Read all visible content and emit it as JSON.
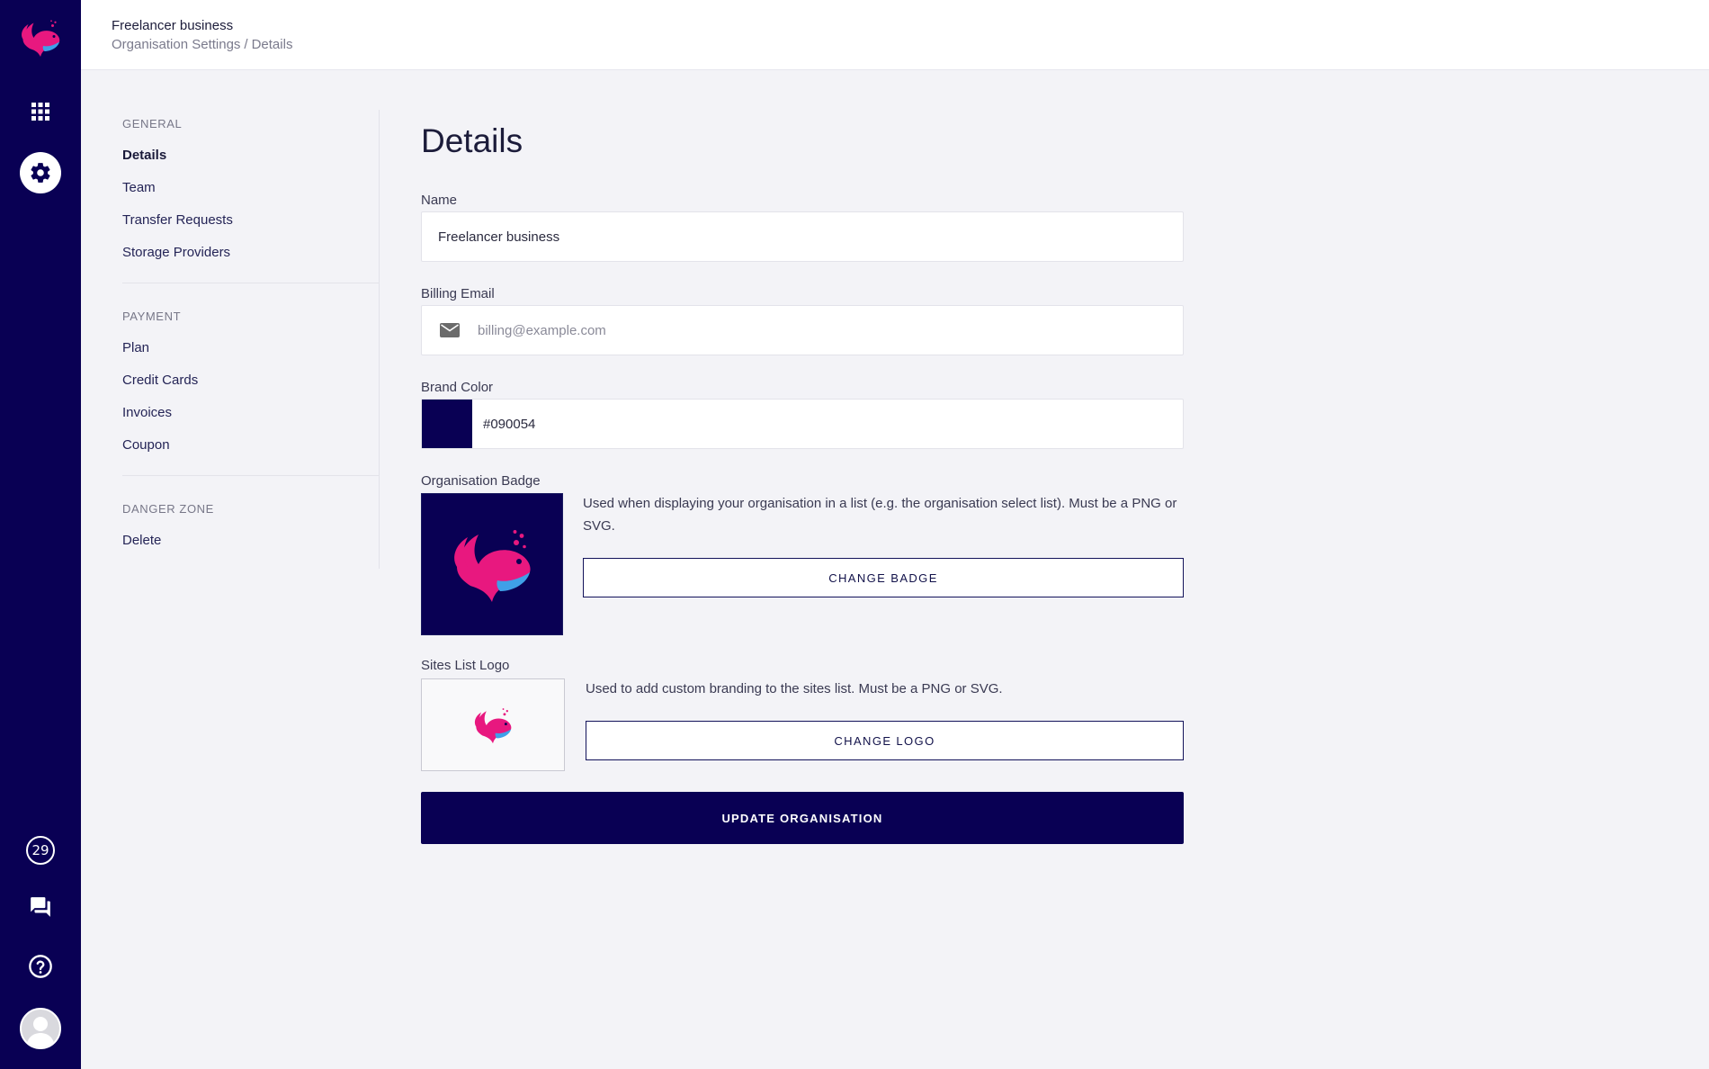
{
  "header": {
    "org_name": "Freelancer business",
    "breadcrumb": [
      "Organisation Settings",
      "Details"
    ],
    "separator": "/"
  },
  "rail": {
    "icons": [
      "whale-logo-icon",
      "apps-grid-icon",
      "settings-gear-icon",
      "updates-count-icon",
      "chat-icon",
      "help-icon",
      "avatar-icon"
    ],
    "updates_count": "29"
  },
  "sidenav": {
    "general_heading": "GENERAL",
    "general_items": [
      "Details",
      "Team",
      "Transfer Requests",
      "Storage Providers"
    ],
    "payment_heading": "PAYMENT",
    "payment_items": [
      "Plan",
      "Credit Cards",
      "Invoices",
      "Coupon"
    ],
    "danger_heading": "DANGER ZONE",
    "danger_items": [
      "Delete"
    ],
    "active_item": "Details"
  },
  "main": {
    "title": "Details",
    "name_label": "Name",
    "name_value": "Freelancer business",
    "billing_label": "Billing Email",
    "billing_placeholder": "billing@example.com",
    "brand_label": "Brand Color",
    "brand_value": "#090054",
    "badge_label": "Organisation Badge",
    "badge_desc": "Used when displaying your organisation in a list (e.g. the organisation select list). Must be a PNG or SVG.",
    "badge_button": "CHANGE BADGE",
    "logo_label": "Sites List Logo",
    "logo_desc": "Used to add custom branding to the sites list. Must be a PNG or SVG.",
    "logo_button": "CHANGE LOGO",
    "submit_button": "UPDATE ORGANISATION"
  },
  "colors": {
    "brand": "#090054",
    "accent_pink": "#e8187f",
    "accent_blue": "#3fa0e8",
    "background": "#f3f3f7"
  }
}
